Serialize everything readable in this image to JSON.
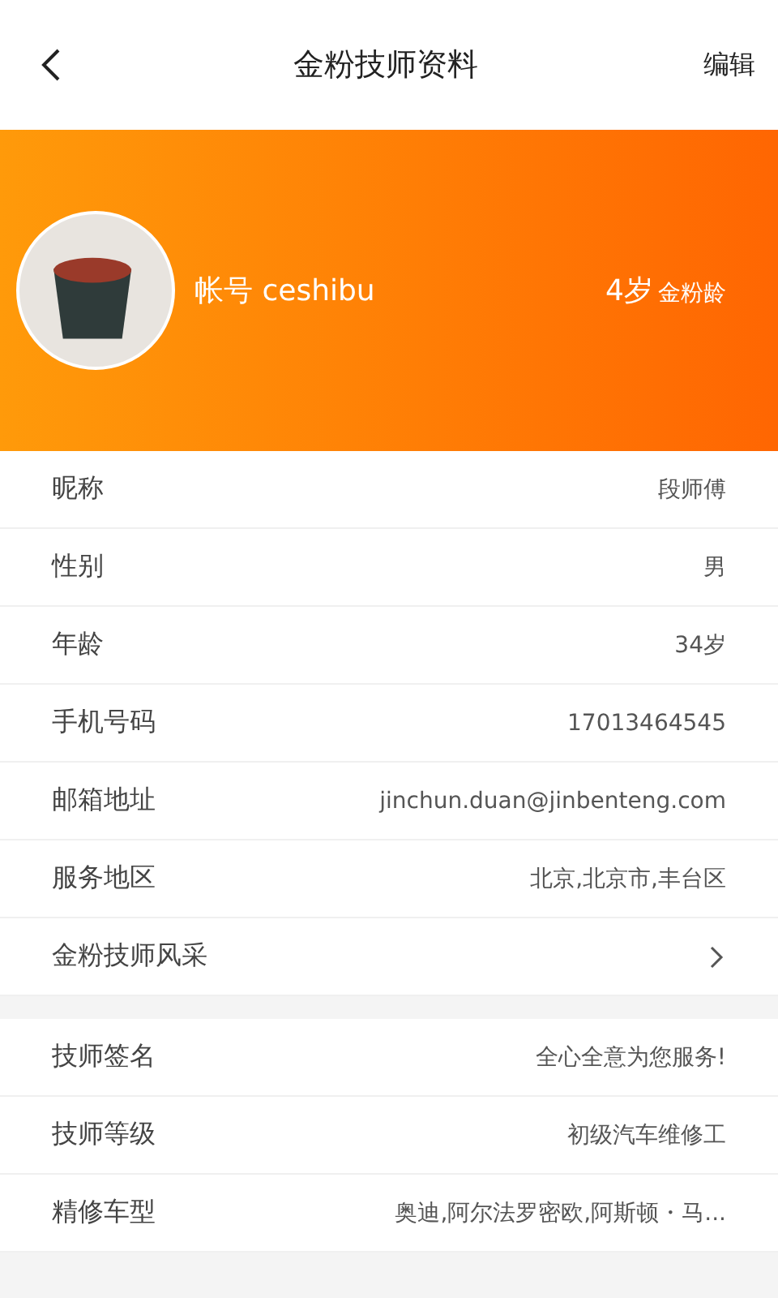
{
  "header": {
    "title": "金粉技师资料",
    "action": "编辑"
  },
  "profile": {
    "account_label": "帐号",
    "account": "ceshibu",
    "age": "4岁",
    "age_label": "金粉龄"
  },
  "sections": [
    {
      "rows": [
        {
          "kind": "text",
          "label": "昵称",
          "value": "段师傅"
        },
        {
          "kind": "text",
          "label": "性别",
          "value": "男"
        },
        {
          "kind": "text",
          "label": "年龄",
          "value": "34岁"
        },
        {
          "kind": "text",
          "label": "手机号码",
          "value": "17013464545"
        },
        {
          "kind": "text",
          "label": "邮箱地址",
          "value": "jinchun.duan@jinbenteng.com"
        },
        {
          "kind": "text",
          "label": "服务地区",
          "value": "北京,北京市,丰台区"
        },
        {
          "kind": "link",
          "label": "金粉技师风采"
        }
      ]
    },
    {
      "rows": [
        {
          "kind": "text",
          "label": "技师签名",
          "value": "全心全意为您服务!"
        },
        {
          "kind": "text",
          "label": "技师等级",
          "value": "初级汽车维修工"
        },
        {
          "kind": "text",
          "label": "精修车型",
          "value": "奥迪,阿尔法罗密欧,阿斯顿・马..."
        }
      ]
    }
  ]
}
